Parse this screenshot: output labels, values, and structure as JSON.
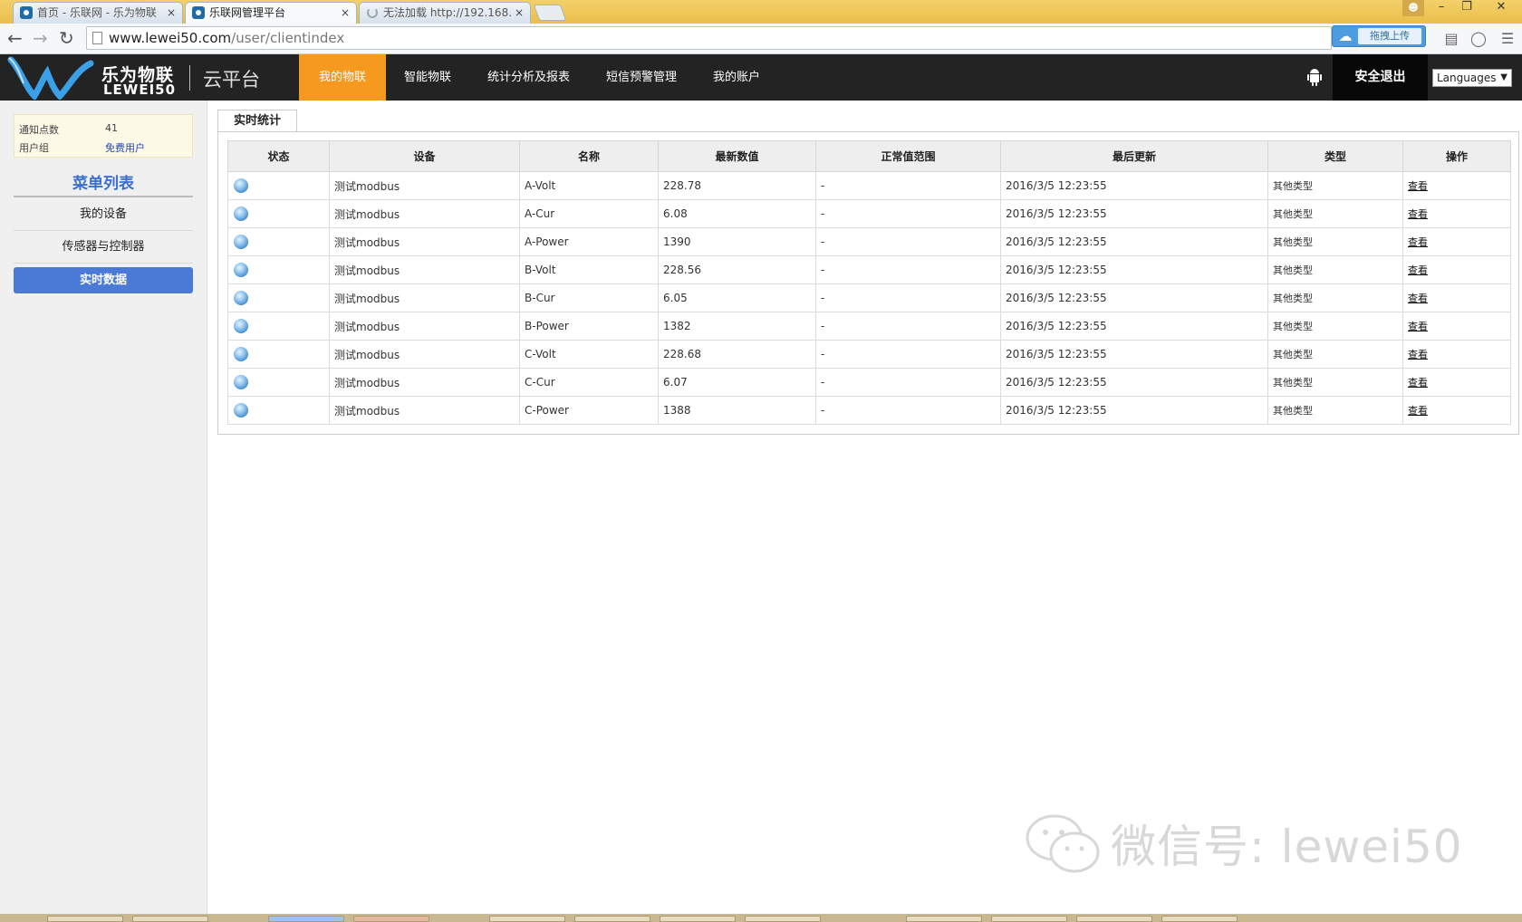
{
  "browser": {
    "tabs": [
      {
        "label": "首页 - 乐联网 - 乐为物联",
        "close": "×"
      },
      {
        "label": "乐联网管理平台",
        "close": "×"
      },
      {
        "label": "无法加载 http://192.168.",
        "close": "×"
      }
    ],
    "url_host": "www.lewei50.com",
    "url_path": "/user/clientindex",
    "upload_label": "拖拽上传"
  },
  "header": {
    "logo_cn": "乐为物联",
    "logo_en": "LEWEI50",
    "platform": "云平台",
    "nav": [
      "我的物联",
      "智能物联",
      "统计分析及报表",
      "短信预警管理",
      "我的账户"
    ],
    "logout": "安全退出",
    "languages": "Languages"
  },
  "sidebar": {
    "info": [
      {
        "label": "通知点数",
        "value": "41"
      },
      {
        "label": "用户组",
        "value": "免费用户"
      }
    ],
    "menu_title": "菜单列表",
    "menu": [
      "我的设备",
      "传感器与控制器",
      "实时数据"
    ]
  },
  "main": {
    "tab": "实时统计",
    "columns": [
      "状态",
      "设备",
      "名称",
      "最新数值",
      "正常值范围",
      "最后更新",
      "类型",
      "操作"
    ],
    "rows": [
      {
        "device": "测试modbus",
        "name": "A-Volt",
        "value": "228.78",
        "range": "-",
        "updated": "2016/3/5 12:23:55",
        "type": "其他类型",
        "action": "查看"
      },
      {
        "device": "测试modbus",
        "name": "A-Cur",
        "value": "6.08",
        "range": "-",
        "updated": "2016/3/5 12:23:55",
        "type": "其他类型",
        "action": "查看"
      },
      {
        "device": "测试modbus",
        "name": "A-Power",
        "value": "1390",
        "range": "-",
        "updated": "2016/3/5 12:23:55",
        "type": "其他类型",
        "action": "查看"
      },
      {
        "device": "测试modbus",
        "name": "B-Volt",
        "value": "228.56",
        "range": "-",
        "updated": "2016/3/5 12:23:55",
        "type": "其他类型",
        "action": "查看"
      },
      {
        "device": "测试modbus",
        "name": "B-Cur",
        "value": "6.05",
        "range": "-",
        "updated": "2016/3/5 12:23:55",
        "type": "其他类型",
        "action": "查看"
      },
      {
        "device": "测试modbus",
        "name": "B-Power",
        "value": "1382",
        "range": "-",
        "updated": "2016/3/5 12:23:55",
        "type": "其他类型",
        "action": "查看"
      },
      {
        "device": "测试modbus",
        "name": "C-Volt",
        "value": "228.68",
        "range": "-",
        "updated": "2016/3/5 12:23:55",
        "type": "其他类型",
        "action": "查看"
      },
      {
        "device": "测试modbus",
        "name": "C-Cur",
        "value": "6.07",
        "range": "-",
        "updated": "2016/3/5 12:23:55",
        "type": "其他类型",
        "action": "查看"
      },
      {
        "device": "测试modbus",
        "name": "C-Power",
        "value": "1388",
        "range": "-",
        "updated": "2016/3/5 12:23:55",
        "type": "其他类型",
        "action": "查看"
      }
    ]
  },
  "watermark": "微信号: lewei50",
  "colors": {
    "nav_active": "#f59a1f",
    "menu_active": "#4a7ad6",
    "menu_title": "#3a6fce",
    "header_bg": "#232323"
  }
}
